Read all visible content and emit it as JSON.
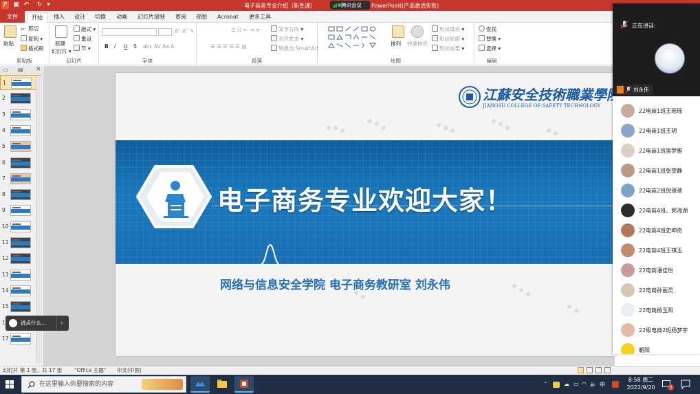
{
  "titlebar": {
    "doc_title": "电子商务专业介绍（新生课）",
    "meeting_app": "腾讯会议",
    "title_suffix": "PowerPoint(产品激活失败)"
  },
  "tabs": [
    "文件",
    "开始",
    "插入",
    "设计",
    "切换",
    "动画",
    "幻灯片放映",
    "审阅",
    "视图",
    "Acrobat",
    "更多工具"
  ],
  "ribbon": {
    "clipboard": {
      "paste": "粘贴",
      "cut": "剪切",
      "copy": "复制",
      "format_painter": "格式刷",
      "label": "剪贴板"
    },
    "slides": {
      "new_slide_1": "新建",
      "new_slide_2": "幻灯片",
      "layout": "版式",
      "reset": "重设",
      "section": "节",
      "label": "幻灯片"
    },
    "font": {
      "bold": "B",
      "italic": "I",
      "underline": "U",
      "shadow": "S",
      "label": "字体"
    },
    "paragraph": {
      "text_direction": "文字方向",
      "align_text": "对齐文本",
      "smartart": "转换为 SmartArt",
      "label": "段落"
    },
    "drawing": {
      "arrange": "排列",
      "quick_styles": "快速样式",
      "shape_fill": "形状填充",
      "shape_outline": "形状轮廓",
      "shape_effects": "形状效果",
      "label": "绘图"
    },
    "editing": {
      "find": "查找",
      "replace": "替换",
      "select": "选择",
      "label": "编辑"
    }
  },
  "thumbnails": [
    "1",
    "2",
    "3",
    "4",
    "5",
    "6",
    "7",
    "8",
    "9",
    "10",
    "11",
    "12",
    "13",
    "14",
    "15",
    "16",
    "17"
  ],
  "slide": {
    "school_cn": "江蘇安全技術職業學院",
    "school_en": "JIANGSU COLLEGE OF SAFETY TECHNOLOGY",
    "title": "电子商务专业欢迎大家！",
    "subtitle": "网络与信息安全学院 电子商务教研室  刘永伟"
  },
  "annotation": {
    "placeholder": "说点什么..."
  },
  "statusbar": {
    "slide_info": "幻灯片 第 1 张，共 17 张",
    "theme": "\"Office 主题\"",
    "language": "中文(中国)"
  },
  "meeting": {
    "speaking_label": "正在讲话:",
    "speaker_name": "刘永伟",
    "participants": [
      {
        "name": "22电商1班王瑶瑶",
        "color": "#c9a9a0"
      },
      {
        "name": "22电商1班王玥",
        "color": "#8aa7c9"
      },
      {
        "name": "22电商1班吴梦雅",
        "color": "#d9cfc2"
      },
      {
        "name": "22电商1班张雯静",
        "color": "#b89a86"
      },
      {
        "name": "22电商2班倪蓓蓓",
        "color": "#7fa2c8"
      },
      {
        "name": "22电商4班、郭海湖",
        "color": "#2c2c2c"
      },
      {
        "name": "22电商4班史坤奇",
        "color": "#b07a5a"
      },
      {
        "name": "22电商4班王祺玉",
        "color": "#c48a6f"
      },
      {
        "name": "22电商潘佳怡",
        "color": "#c99a9a"
      },
      {
        "name": "22电商孙丽灵",
        "color": "#d8c7b0"
      },
      {
        "name": "22电商杨玉阳",
        "color": "#e8eef4"
      },
      {
        "name": "22级电商2班杨梦宇",
        "color": "#e4b9a8"
      },
      {
        "name": "朝阳",
        "color": "#f5d020"
      }
    ]
  },
  "taskbar": {
    "search_placeholder": "在这里输入你要搜索的内容",
    "ime": "中",
    "time": "8:58 周二",
    "date": "2022/9/20",
    "notif_count": "3"
  },
  "colors": {
    "accent": "#c8372d",
    "slide_blue": "#1978bc",
    "taskbar": "#1f2e42"
  }
}
